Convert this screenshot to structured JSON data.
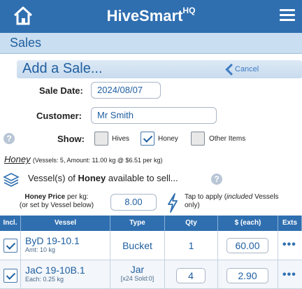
{
  "app": {
    "title": "HiveSmart",
    "title_sup": "HQ"
  },
  "section": {
    "title": "Sales"
  },
  "add_sale": {
    "title": "Add a Sale...",
    "cancel_label": "Cancel"
  },
  "form": {
    "sale_date_label": "Sale Date:",
    "sale_date_value": "2024/08/07",
    "customer_label": "Customer:",
    "customer_value": "Mr Smith",
    "show_label": "Show:",
    "show_options": [
      {
        "label": "Hives",
        "checked": false
      },
      {
        "label": "Honey",
        "checked": true
      },
      {
        "label": "Other Items",
        "checked": false
      }
    ]
  },
  "honey_summary": {
    "product": "Honey",
    "details": "(Vessels: 5, Amount: 11.00 kg @ $6.51 per kg)"
  },
  "vessels_available": {
    "prefix": "Vessel(s) of ",
    "product": "Honey",
    "suffix": " available to sell..."
  },
  "price": {
    "label_bold": "Honey Price",
    "label_rest": " per kg:",
    "label_line2": "(or set by Vessel below)",
    "value": "8.00",
    "apply_line1": "Tap to apply (",
    "apply_included": "included",
    "apply_line1_end": " Vessels",
    "apply_line2": "only)"
  },
  "table": {
    "headers": [
      "Incl.",
      "Vessel",
      "Type",
      "Qty",
      "$ (each)",
      "Exts"
    ],
    "rows": [
      {
        "checked": true,
        "vessel": "ByD 19-10.1",
        "sub": "Amt: 10 kg",
        "type": "Bucket",
        "type_sub": "",
        "qty": "1",
        "qty_editable": false,
        "price": "60.00",
        "exts": "•••"
      },
      {
        "checked": true,
        "vessel": "JaC 19-10B.1",
        "sub": "Each: 0.25 kg",
        "type": "Jar",
        "type_sub": "[x24 Sold:0]",
        "qty": "4",
        "qty_editable": true,
        "price": "2.90",
        "exts": "•••"
      }
    ]
  },
  "colors": {
    "primary": "#2f6fb0",
    "section_bg": "#c9def0"
  }
}
